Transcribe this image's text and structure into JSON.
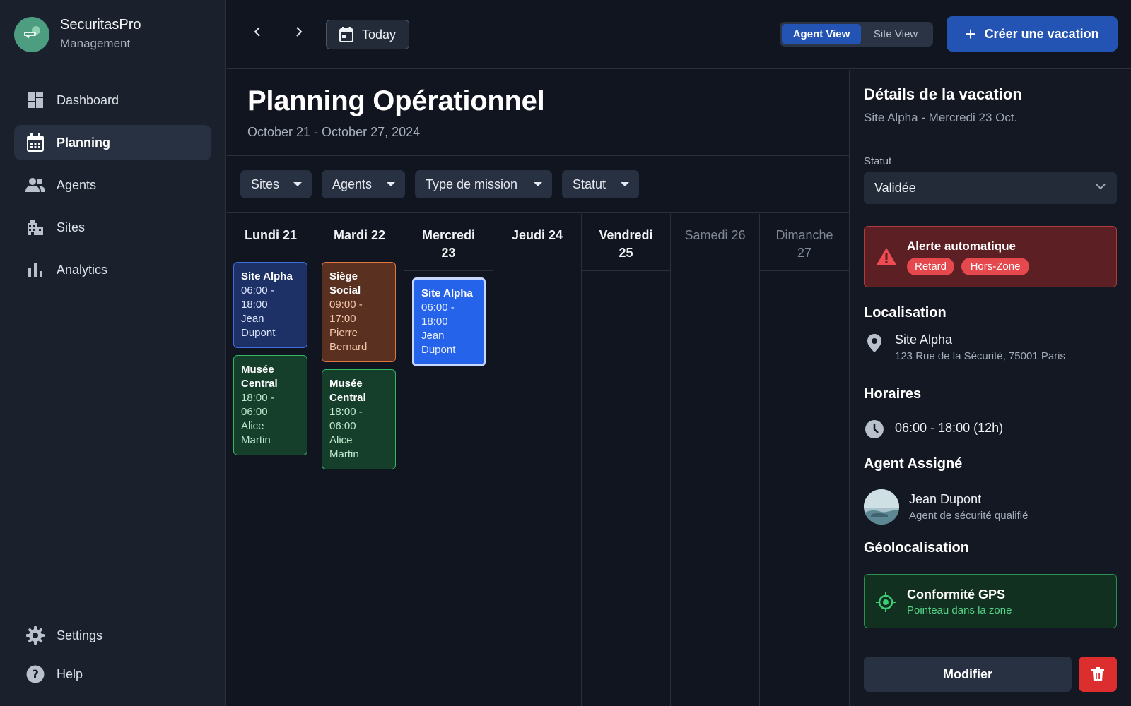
{
  "brand": {
    "name": "SecuritasPro",
    "subtitle": "Management"
  },
  "sidebar": {
    "items": [
      {
        "label": "Dashboard",
        "icon": "dashboard-icon",
        "active": false
      },
      {
        "label": "Planning",
        "icon": "calendar-icon",
        "active": true
      },
      {
        "label": "Agents",
        "icon": "people-icon",
        "active": false
      },
      {
        "label": "Sites",
        "icon": "building-icon",
        "active": false
      },
      {
        "label": "Analytics",
        "icon": "bar-chart-icon",
        "active": false
      }
    ],
    "bottom": [
      {
        "label": "Settings",
        "icon": "gear-icon"
      },
      {
        "label": "Help",
        "icon": "help-icon"
      }
    ]
  },
  "topbar": {
    "today_label": "Today",
    "view_toggle": {
      "options": [
        "Agent View",
        "Site View"
      ],
      "selected": "Agent View"
    },
    "create_label": "Créer une vacation"
  },
  "page": {
    "title": "Planning Opérationnel",
    "range": "October 21 - October 27, 2024"
  },
  "filters": [
    "Sites",
    "Agents",
    "Type de mission",
    "Statut"
  ],
  "calendar": {
    "days": [
      {
        "line1": "Lundi 21",
        "line2": "",
        "weekend": false
      },
      {
        "line1": "Mardi 22",
        "line2": "",
        "weekend": false
      },
      {
        "line1": "Mercredi",
        "line2": "23",
        "weekend": false
      },
      {
        "line1": "Jeudi 24",
        "line2": "",
        "weekend": false
      },
      {
        "line1": "Vendredi",
        "line2": "25",
        "weekend": false
      },
      {
        "line1": "Samedi 26",
        "line2": "",
        "weekend": true
      },
      {
        "line1": "Dimanche",
        "line2": "27",
        "weekend": true
      }
    ],
    "shifts": [
      {
        "day": 0,
        "name": "Site Alpha",
        "lines": [
          "06:00 -",
          "18:00",
          "Jean",
          "Dupont"
        ],
        "color": "blue"
      },
      {
        "day": 0,
        "name": "Musée Central",
        "lines": [
          "18:00 -",
          "06:00",
          "Alice",
          "Martin"
        ],
        "color": "green"
      },
      {
        "day": 1,
        "name": "Siège Social",
        "lines": [
          "09:00 -",
          "17:00",
          "Pierre",
          "Bernard"
        ],
        "color": "orange"
      },
      {
        "day": 1,
        "name": "Musée Central",
        "lines": [
          "18:00 -",
          "06:00",
          "Alice",
          "Martin"
        ],
        "color": "green"
      },
      {
        "day": 2,
        "name": "Site Alpha",
        "lines": [
          "06:00 -",
          "18:00",
          "Jean",
          "Dupont"
        ],
        "color": "selected"
      }
    ]
  },
  "details": {
    "title": "Détails de la vacation",
    "subtitle": "Site Alpha - Mercredi 23 Oct.",
    "status_label": "Statut",
    "status_value": "Validée",
    "alert": {
      "title": "Alerte automatique",
      "tags": [
        "Retard",
        "Hors-Zone"
      ]
    },
    "location": {
      "title": "Localisation",
      "name": "Site Alpha",
      "address": "123 Rue de la Sécurité, 75001 Paris"
    },
    "hours": {
      "title": "Horaires",
      "value": "06:00 - 18:00 (12h)"
    },
    "agent": {
      "title": "Agent Assigné",
      "name": "Jean Dupont",
      "role": "Agent de sécurité qualifié"
    },
    "geo": {
      "title": "Géolocalisation",
      "status": "Conformité GPS",
      "detail": "Pointeau dans la zone"
    },
    "modify_label": "Modifier"
  },
  "colors": {
    "accent": "#2454b3",
    "danger": "#dc2e2e",
    "success": "#2fb964",
    "warning": "#e2763f"
  }
}
